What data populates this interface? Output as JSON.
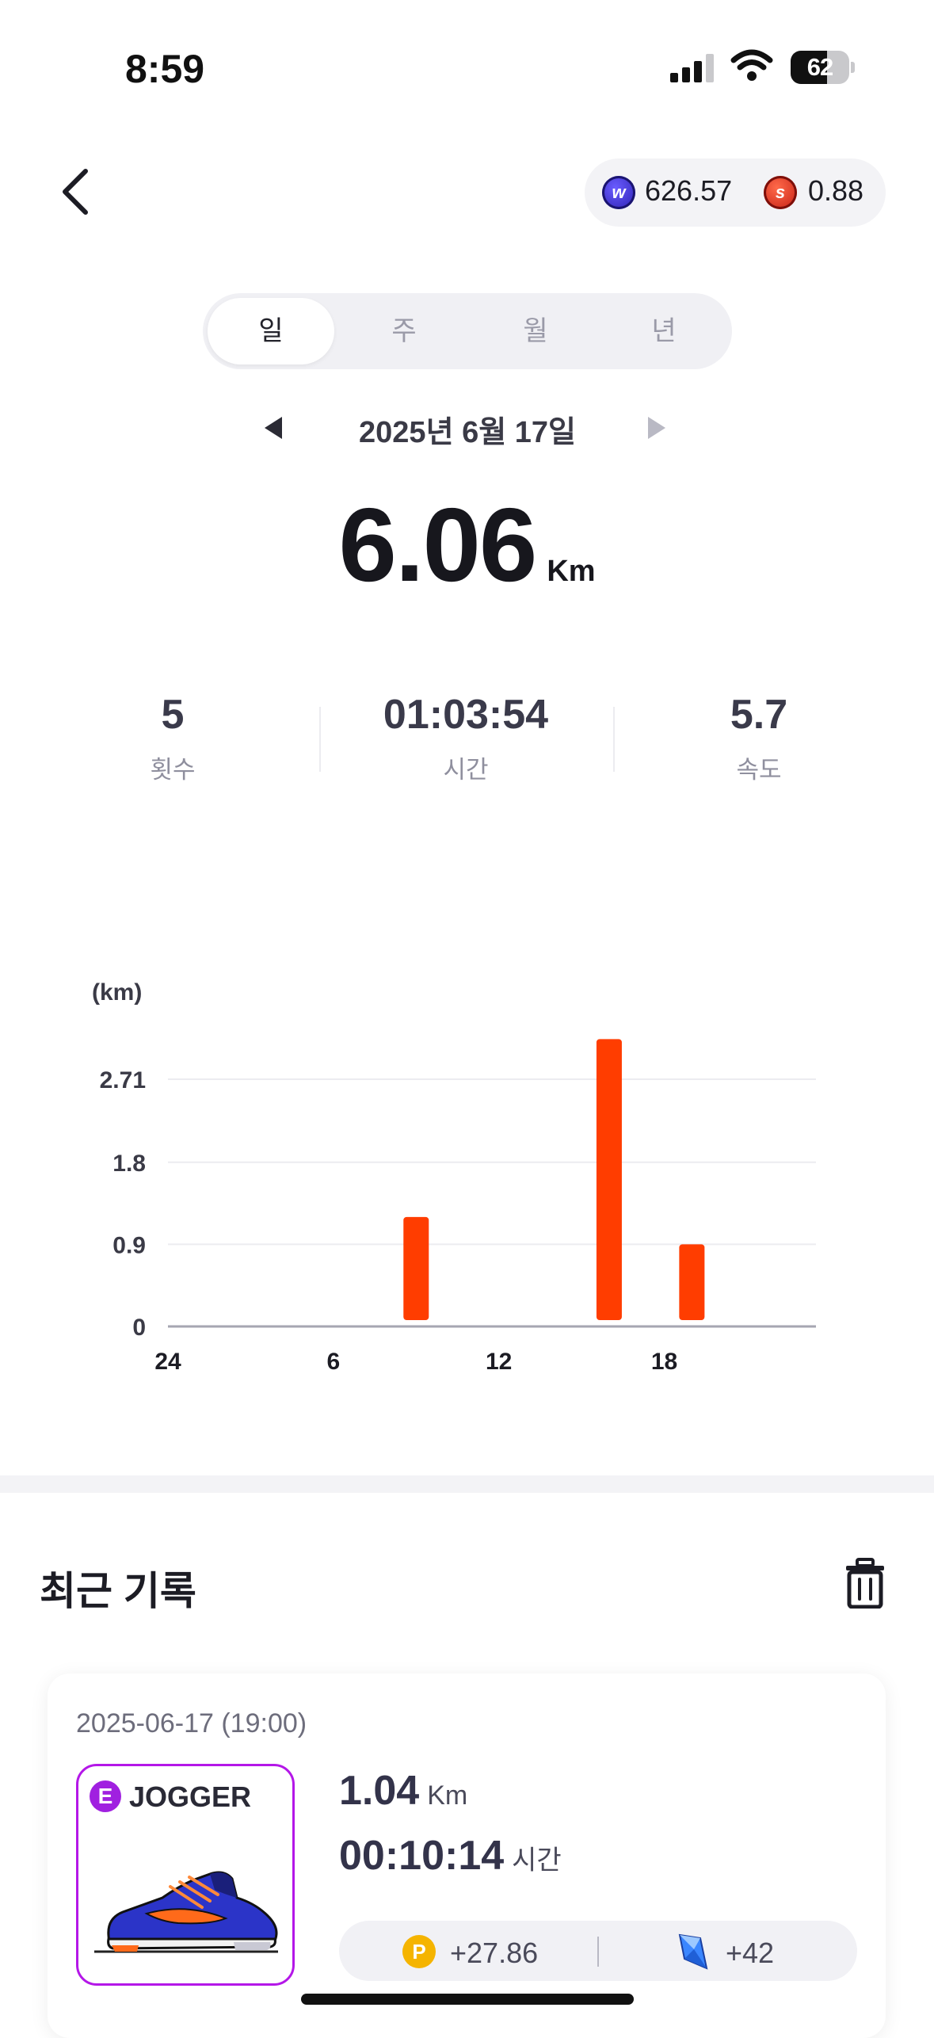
{
  "status_bar": {
    "time": "8:59",
    "battery": "62",
    "battery_level": 0.62
  },
  "header": {
    "balances": [
      {
        "icon": "w-token-coin-icon",
        "value": "626.57"
      },
      {
        "icon": "s-token-coin-icon",
        "value": "0.88"
      }
    ]
  },
  "period_tabs": {
    "items": [
      "일",
      "주",
      "월",
      "년"
    ],
    "selected": "일"
  },
  "date_nav": {
    "date": "2025년 6월 17일"
  },
  "summary": {
    "distance": "6.06",
    "unit": "Km"
  },
  "stats": [
    {
      "value": "5",
      "label": "횟수"
    },
    {
      "value": "01:03:54",
      "label": "시간"
    },
    {
      "value": "5.7",
      "label": "속도"
    }
  ],
  "chart_data": {
    "type": "bar",
    "ylabel": "(km)",
    "yticks": [
      "2.71",
      "1.8",
      "0.9",
      "0"
    ],
    "ylim": [
      0,
      2.71
    ],
    "xlim": [
      0,
      23.5
    ],
    "xticks": [
      {
        "label": "24",
        "value": 0
      },
      {
        "label": "6",
        "value": 6
      },
      {
        "label": "12",
        "value": 12
      },
      {
        "label": "18",
        "value": 18
      }
    ],
    "bars": [
      {
        "hour": 9,
        "value": 1.2
      },
      {
        "hour": 16,
        "value": 3.15
      },
      {
        "hour": 19,
        "value": 0.9
      }
    ],
    "bar_color": "#ff3d00",
    "grid": true
  },
  "recent": {
    "title": "최근 기록",
    "records": [
      {
        "datetime": "2025-06-17 (19:00)",
        "grade": "E",
        "shoe_type": "JOGGER",
        "distance": "1.04",
        "distance_unit": "Km",
        "time": "00:10:14",
        "time_unit": "시간",
        "point_reward": "+27.86",
        "gem_reward": "+42"
      }
    ]
  },
  "colors": {
    "accent": "#ff3d00",
    "grade_epic": "#a020e0"
  }
}
